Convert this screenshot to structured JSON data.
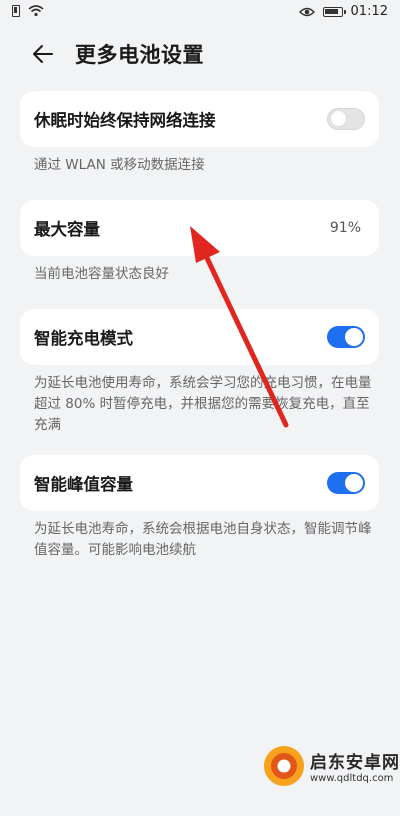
{
  "status_bar": {
    "time": "01:12"
  },
  "header": {
    "title": "更多电池设置"
  },
  "settings": [
    {
      "label": "休眠时始终保持网络连接",
      "toggle": "off",
      "description": "通过 WLAN 或移动数据连接"
    },
    {
      "label": "最大容量",
      "value": "91%",
      "description": "当前电池容量状态良好"
    },
    {
      "label": "智能充电模式",
      "toggle": "on",
      "description": "为延长电池使用寿命，系统会学习您的充电习惯，在电量超过 80% 时暂停充电，并根据您的需要恢复充电，直至充满"
    },
    {
      "label": "智能峰值容量",
      "toggle": "on",
      "description": "为延长电池寿命，系统会根据电池自身状态，智能调节峰值容量。可能影响电池续航"
    }
  ],
  "watermark": {
    "name": "启东安卓网",
    "url": "www.qdltdq.com"
  },
  "colors": {
    "accent": "#1e6ff0",
    "annotation_arrow": "#e0261f",
    "background": "#f1f3f5"
  }
}
